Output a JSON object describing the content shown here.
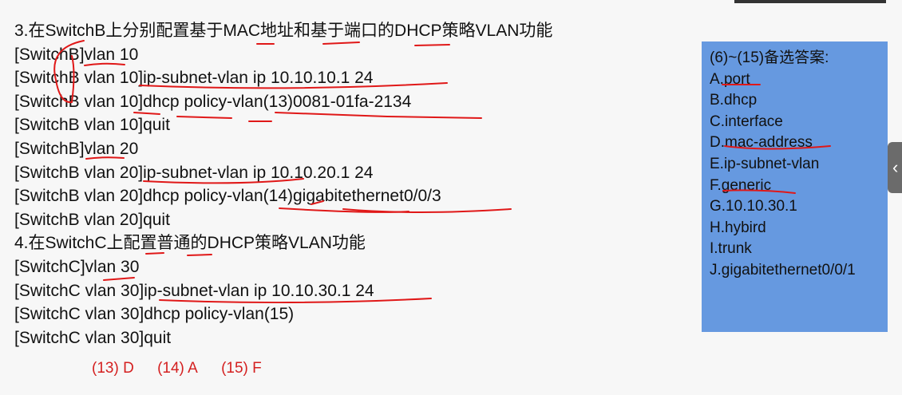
{
  "lines": [
    "3.在SwitchB上分别配置基于MAC地址和基于端口的DHCP策略VLAN功能",
    "[SwitchB]vlan 10",
    "[SwitchB vlan 10]ip-subnet-vlan ip 10.10.10.1 24",
    "[SwitchB vlan 10]dhcp policy-vlan(13)0081-01fa-2134",
    "[SwitchB vlan 10]quit",
    "[SwitchB]vlan 20",
    "[SwitchB vlan 20]ip-subnet-vlan ip 10.10.20.1 24",
    "[SwitchB vlan 20]dhcp policy-vlan(14)gigabitethernet0/0/3",
    "[SwitchB vlan 20]quit",
    "4.在SwitchC上配置普通的DHCP策略VLAN功能",
    "[SwitchC]vlan 30",
    "[SwitchC vlan 30]ip-subnet-vlan ip 10.10.30.1 24",
    "[SwitchC vlan 30]dhcp policy-vlan(15)",
    "[SwitchC vlan 30]quit"
  ],
  "answers": [
    "(13) D",
    "(14) A",
    "(15) F"
  ],
  "panel": {
    "title": "(6)~(15)备选答案:",
    "options": [
      "A.port",
      "B.dhcp",
      "C.interface",
      "D.mac-address",
      "E.ip-subnet-vlan",
      "F.generic",
      "G.10.10.30.1",
      "H.hybird",
      "I.trunk",
      "J.gigabitethernet0/0/1"
    ]
  },
  "sidetab": {
    "icon": "chevron-left-icon",
    "glyph": "‹"
  },
  "colors": {
    "panel": "#6699e0",
    "annotation": "#e01818"
  }
}
